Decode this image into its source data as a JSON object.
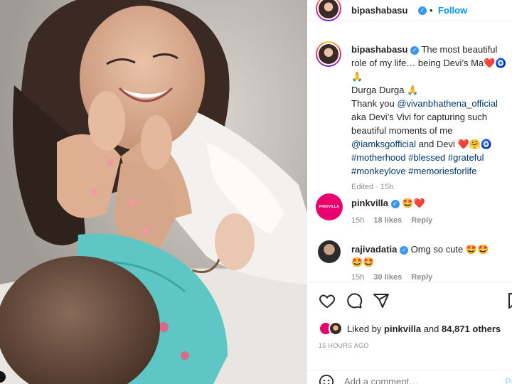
{
  "post": {
    "author": "bipashabasu",
    "follow_label": "Follow",
    "caption": {
      "author": "bipashabasu",
      "line1": "The most beautiful role of my life… being Devi’s Ma",
      "line1_emojis": "❤️🧿",
      "line2": "🙏",
      "line3": "Durga Durga 🙏",
      "line4_prefix": "Thank you ",
      "mention_vivan": "@vivanbhathena_official",
      "line4_rest": "aka Devi’s Vivi for capturing such beautiful moments of me",
      "mention_iamks": "@iamksgofficial",
      "line5_rest": " and Devi ❤️🤗🧿",
      "hashtags_line1": "#motherhood #blessed #grateful",
      "hashtags_line2": "#monkeylove #memoriesforlife",
      "edited": "Edited · 15h"
    },
    "comments": [
      {
        "user": "pinkvilla",
        "avatar_text": "PINKVILLA",
        "text": "🤩❤️",
        "time": "15h",
        "likes": "18 likes",
        "reply": "Reply"
      },
      {
        "user": "rajivadatia",
        "text": "Omg so cute 🤩🤩",
        "text2": "🤩🤩",
        "time": "15h",
        "likes": "30 likes",
        "reply": "Reply"
      }
    ],
    "liked_by_prefix": "Liked by ",
    "liked_by_user": "pinkvilla",
    "liked_by_and": " and ",
    "liked_by_count": "84,871 others",
    "time_ago": "15 HOURS AGO",
    "add_comment_placeholder": "Add a comment…",
    "post_label": "Po"
  },
  "colors": {
    "link": "#00376b",
    "follow": "#0095f6",
    "muted": "#8e8e8e",
    "verified": "#3897f0"
  },
  "icons": [
    "heart-icon",
    "comment-icon",
    "share-icon",
    "emoji-icon",
    "verified-icon"
  ]
}
